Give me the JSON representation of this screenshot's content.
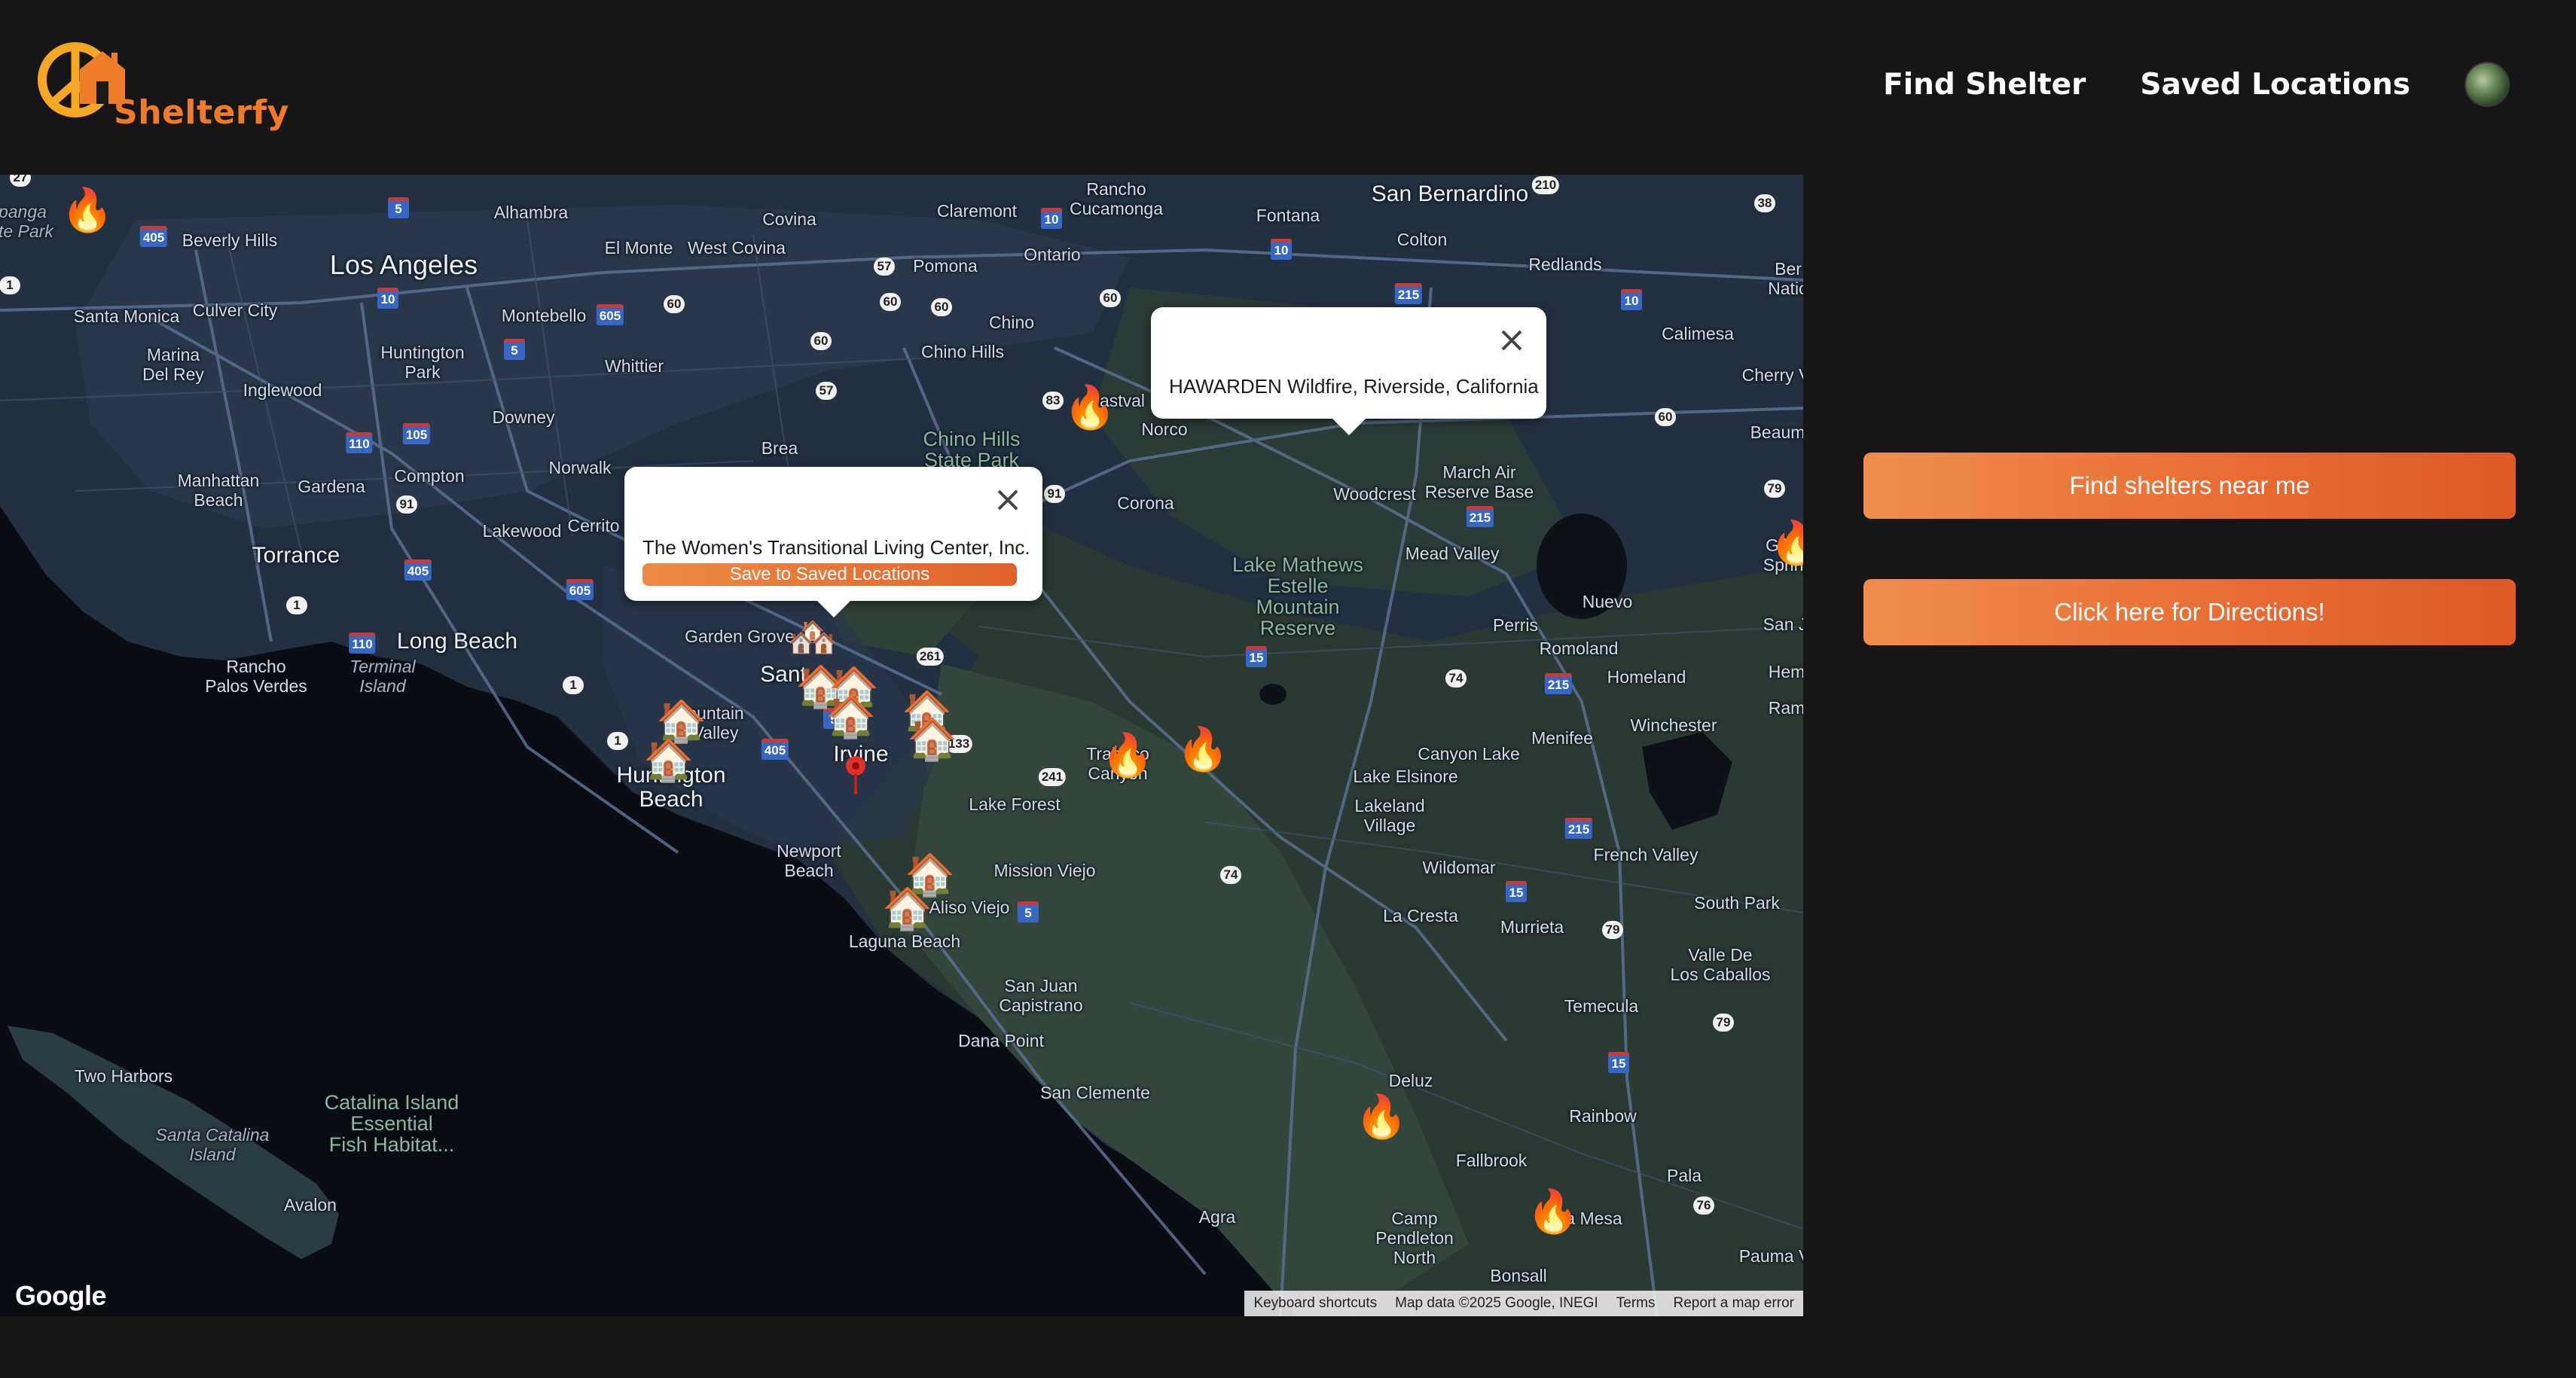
{
  "brand": {
    "name": "Shelterfy"
  },
  "nav": {
    "find_shelter": "Find Shelter",
    "saved_locations": "Saved Locations"
  },
  "actions": {
    "find_near_me": "Find shelters near me",
    "directions": "Click here for Directions!"
  },
  "map": {
    "provider_logo": "Google",
    "attribution": {
      "shortcuts": "Keyboard shortcuts",
      "map_data": "Map data ©2025 Google, INEGI",
      "terms": "Terms",
      "report": "Report a map error"
    },
    "labels": {
      "topanga": "opanga\nate Park",
      "alhambra": "Alhambra",
      "covina": "Covina",
      "claremont": "Claremont",
      "rancho_cucamonga": "Rancho\nCucamonga",
      "fontana": "Fontana",
      "san_bernardino": "San Bernardino",
      "beverly_hills": "Beverly Hills",
      "el_monte": "El Monte",
      "west_covina": "West Covina",
      "pomona": "Pomona",
      "ontario": "Ontario",
      "colton": "Colton",
      "redlands": "Redlands",
      "bernardino_natl": "Ber\nNatio",
      "los_angeles": "Los Angeles",
      "santa_monica": "Santa Monica",
      "culver_city": "Culver City",
      "montebello": "Montebello",
      "chino": "Chino",
      "calimesa": "Calimesa",
      "marina_del_rey": "Marina\nDel Rey",
      "huntington_park": "Huntington\nPark",
      "whittier": "Whittier",
      "chino_hills": "Chino Hills",
      "cherry_valley": "Cherry V",
      "inglewood": "Inglewood",
      "downey": "Downey",
      "chino_hills_sp": "Chino Hills\nState Park",
      "eastvale": "astval",
      "norco": "Norco",
      "beaumont": "Beaum",
      "brea": "Brea",
      "compton": "Compton",
      "norwalk": "Norwalk",
      "manhattan_beach": "Manhattan\nBeach",
      "gardena": "Gardena",
      "march_air": "March Air\nReserve Base",
      "corona": "Corona",
      "woodcrest": "Woodcrest",
      "lakewood": "Lakewood",
      "cerritos": "Cerrito",
      "torrance": "Torrance",
      "mead_valley": "Mead Valley",
      "gilman_springs": "Gilma\nSpring",
      "lake_mathews": "Lake Mathews\nEstelle\nMountain\nReserve",
      "perris": "Perris",
      "nuevo": "Nuevo",
      "long_beach": "Long Beach",
      "garden_grove": "Garden Grove",
      "romoland": "Romoland",
      "san_jacinto": "San J",
      "rancho_palos_verdes": "Rancho\nPalos Verdes",
      "terminal_island": "Terminal\nIsland",
      "santa_ana": "Sant",
      "homeland": "Homeland",
      "hemet": "Hem",
      "fountain_valley": "ountain\nValley",
      "ramona": "Ram",
      "winchester": "Winchester",
      "menifee": "Menifee",
      "irvine": "Irvine",
      "trabuco_canyon": "Trabuco\nCanyon",
      "canyon_lake": "Canyon Lake",
      "huntington_beach": "Huntington\nBeach",
      "lake_elsinore": "Lake Elsinore",
      "lake_forest": "Lake Forest",
      "lakeland_village": "Lakeland\nVillage",
      "newport_beach": "Newport\nBeach",
      "mission_viejo": "Mission Viejo",
      "wildomar": "Wildomar",
      "french_valley": "French Valley",
      "aliso_viejo": "Aliso Viejo",
      "south_park": "South Park",
      "la_cresta": "La Cresta",
      "murrieta": "Murrieta",
      "laguna_beach": "Laguna Beach",
      "valle_de_los_caballos": "Valle De\nLos Caballos",
      "san_juan_capistrano": "San Juan\nCapistrano",
      "temecula": "Temecula",
      "dana_point": "Dana Point",
      "two_harbors": "Two Harbors",
      "catalina_habitat": "Catalina Island\nEssential\nFish Habitat...",
      "san_clemente": "San Clemente",
      "deluz": "Deluz",
      "rainbow": "Rainbow",
      "santa_catalina": "Santa Catalina\nIsland",
      "pala": "Pala",
      "fallbrook": "Fallbrook",
      "avalon": "Avalon",
      "agra": "Agra",
      "camp_pendleton": "Camp\nPendleton\nNorth",
      "la_mesa": "a Mesa",
      "pauma": "Pauma V",
      "bonsall": "Bonsall"
    },
    "shelter_popup": {
      "title": "The Women's Transitional Living Center, Inc.",
      "save_button": "Save to Saved Locations"
    },
    "fire_popup": {
      "title": "HAWARDEN Wildfire, Riverside, California"
    },
    "markers": {
      "fire_icon": "fire-icon",
      "shelter_icon": "house-icon",
      "user_pin": "location-pin-icon"
    }
  },
  "colors": {
    "background": "#161616",
    "brand_orange": "#f07a27",
    "button_gradient_start": "#f08d4c",
    "button_gradient_end": "#de5a26",
    "map_land": "#233042",
    "map_water": "#0a0e14"
  }
}
